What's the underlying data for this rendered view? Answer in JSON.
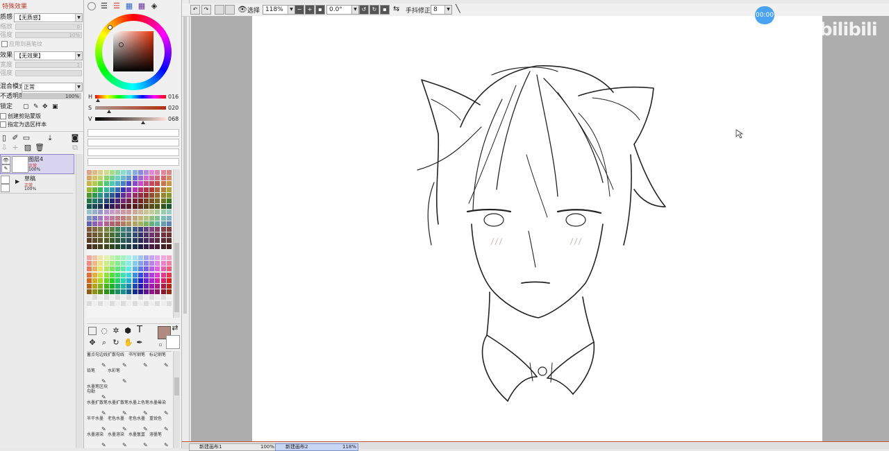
{
  "left_panel": {
    "section_title": "特殊效果",
    "texture_label": "质感",
    "texture_value": "【无质感】",
    "scale_label": "缩放",
    "scale_value": "0",
    "strength_label": "强度",
    "strength_value": "10%",
    "apply_to_brush_label": "应用到画笔纹",
    "effect_label": "效果",
    "effect_value": "【无效果】",
    "width_label": "宽度",
    "width_value": "1",
    "strength2_label": "强度",
    "blend_label": "混合模式",
    "blend_value": "正常",
    "opacity_label": "不透明度",
    "opacity_value": "100%",
    "lock_label": "锁定",
    "clip_label": "创建剪贴蒙版",
    "sample_label": "指定为选区样本",
    "layers": [
      {
        "name": "图层4",
        "mode": "正常",
        "opacity": "100%"
      },
      {
        "name": "草稿",
        "mode": "正常",
        "opacity": "100%"
      }
    ]
  },
  "color_panel": {
    "h_label": "H",
    "h_value": "016",
    "s_label": "S",
    "s_value": "020",
    "v_label": "V",
    "v_value": "068",
    "h_level": 0.04,
    "s_level": 0.2,
    "v_level": 0.68,
    "primary_color": "#b18b80",
    "secondary_color": "#ffffff"
  },
  "tools": {
    "text_tool": "T"
  },
  "brushes": [
    {
      "label": "蓄点勾边线"
    },
    {
      "label": "扩散勾线"
    },
    {
      "label": "书写钢笔"
    },
    {
      "label": "标记钢笔"
    },
    {
      "label": "铅笔"
    },
    {
      "label": "水彩笔"
    },
    {
      "label": ""
    },
    {
      "label": ""
    },
    {
      "label": "水墨笔区块勾勒"
    },
    {
      "label": ""
    },
    {
      "label": ""
    },
    {
      "label": ""
    },
    {
      "label": "水墨扩散笔"
    },
    {
      "label": "水墨扩散笔"
    },
    {
      "label": "水墨上色笔"
    },
    {
      "label": "水墨晕染"
    },
    {
      "label": "半干水墨"
    },
    {
      "label": "老色水墨"
    },
    {
      "label": "老色水墨"
    },
    {
      "label": "重锐色"
    },
    {
      "label": "水墨溶染"
    },
    {
      "label": "水墨溶染"
    },
    {
      "label": "水墨氤氲"
    },
    {
      "label": "溶墨笔"
    }
  ],
  "toolbar": {
    "select_label": "选择",
    "zoom_value": "118%",
    "rotate_value": "0.0°",
    "stabilizer_label": "手抖修正",
    "stabilizer_value": "8"
  },
  "tabs": [
    {
      "label": "新建画布1",
      "zoom": "100%"
    },
    {
      "label": "新建画布2",
      "zoom": "118%"
    }
  ],
  "overlay": {
    "timer": "00:00",
    "watermark": "bilibili"
  },
  "colors": {
    "panel_bg": "#f0f0f0",
    "workspace": "#adadad",
    "timer_bg": "#4aa3f0"
  }
}
